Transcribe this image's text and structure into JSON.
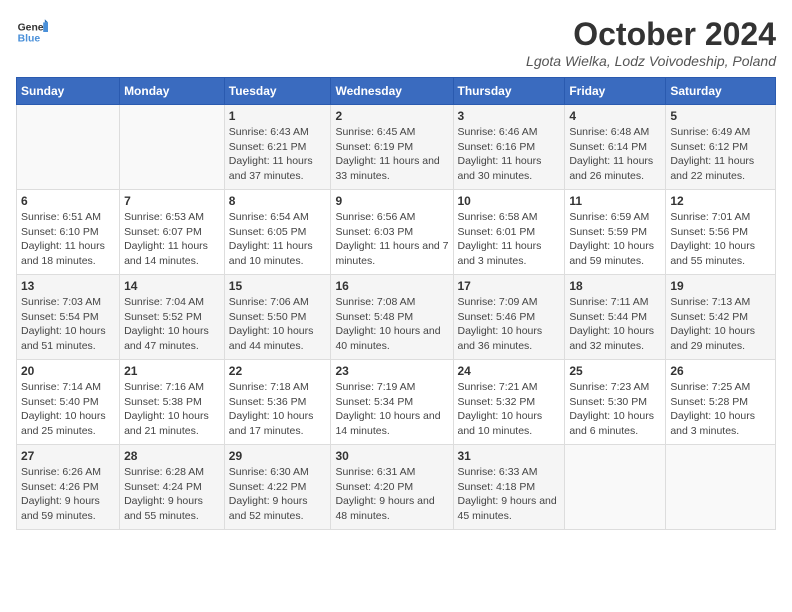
{
  "header": {
    "logo_general": "General",
    "logo_blue": "Blue",
    "title": "October 2024",
    "subtitle": "Lgota Wielka, Lodz Voivodeship, Poland"
  },
  "weekdays": [
    "Sunday",
    "Monday",
    "Tuesday",
    "Wednesday",
    "Thursday",
    "Friday",
    "Saturday"
  ],
  "weeks": [
    [
      {
        "day": "",
        "content": ""
      },
      {
        "day": "",
        "content": ""
      },
      {
        "day": "1",
        "content": "Sunrise: 6:43 AM\nSunset: 6:21 PM\nDaylight: 11 hours\nand 37 minutes."
      },
      {
        "day": "2",
        "content": "Sunrise: 6:45 AM\nSunset: 6:19 PM\nDaylight: 11 hours\nand 33 minutes."
      },
      {
        "day": "3",
        "content": "Sunrise: 6:46 AM\nSunset: 6:16 PM\nDaylight: 11 hours\nand 30 minutes."
      },
      {
        "day": "4",
        "content": "Sunrise: 6:48 AM\nSunset: 6:14 PM\nDaylight: 11 hours\nand 26 minutes."
      },
      {
        "day": "5",
        "content": "Sunrise: 6:49 AM\nSunset: 6:12 PM\nDaylight: 11 hours\nand 22 minutes."
      }
    ],
    [
      {
        "day": "6",
        "content": "Sunrise: 6:51 AM\nSunset: 6:10 PM\nDaylight: 11 hours\nand 18 minutes."
      },
      {
        "day": "7",
        "content": "Sunrise: 6:53 AM\nSunset: 6:07 PM\nDaylight: 11 hours\nand 14 minutes."
      },
      {
        "day": "8",
        "content": "Sunrise: 6:54 AM\nSunset: 6:05 PM\nDaylight: 11 hours\nand 10 minutes."
      },
      {
        "day": "9",
        "content": "Sunrise: 6:56 AM\nSunset: 6:03 PM\nDaylight: 11 hours\nand 7 minutes."
      },
      {
        "day": "10",
        "content": "Sunrise: 6:58 AM\nSunset: 6:01 PM\nDaylight: 11 hours\nand 3 minutes."
      },
      {
        "day": "11",
        "content": "Sunrise: 6:59 AM\nSunset: 5:59 PM\nDaylight: 10 hours\nand 59 minutes."
      },
      {
        "day": "12",
        "content": "Sunrise: 7:01 AM\nSunset: 5:56 PM\nDaylight: 10 hours\nand 55 minutes."
      }
    ],
    [
      {
        "day": "13",
        "content": "Sunrise: 7:03 AM\nSunset: 5:54 PM\nDaylight: 10 hours\nand 51 minutes."
      },
      {
        "day": "14",
        "content": "Sunrise: 7:04 AM\nSunset: 5:52 PM\nDaylight: 10 hours\nand 47 minutes."
      },
      {
        "day": "15",
        "content": "Sunrise: 7:06 AM\nSunset: 5:50 PM\nDaylight: 10 hours\nand 44 minutes."
      },
      {
        "day": "16",
        "content": "Sunrise: 7:08 AM\nSunset: 5:48 PM\nDaylight: 10 hours\nand 40 minutes."
      },
      {
        "day": "17",
        "content": "Sunrise: 7:09 AM\nSunset: 5:46 PM\nDaylight: 10 hours\nand 36 minutes."
      },
      {
        "day": "18",
        "content": "Sunrise: 7:11 AM\nSunset: 5:44 PM\nDaylight: 10 hours\nand 32 minutes."
      },
      {
        "day": "19",
        "content": "Sunrise: 7:13 AM\nSunset: 5:42 PM\nDaylight: 10 hours\nand 29 minutes."
      }
    ],
    [
      {
        "day": "20",
        "content": "Sunrise: 7:14 AM\nSunset: 5:40 PM\nDaylight: 10 hours\nand 25 minutes."
      },
      {
        "day": "21",
        "content": "Sunrise: 7:16 AM\nSunset: 5:38 PM\nDaylight: 10 hours\nand 21 minutes."
      },
      {
        "day": "22",
        "content": "Sunrise: 7:18 AM\nSunset: 5:36 PM\nDaylight: 10 hours\nand 17 minutes."
      },
      {
        "day": "23",
        "content": "Sunrise: 7:19 AM\nSunset: 5:34 PM\nDaylight: 10 hours\nand 14 minutes."
      },
      {
        "day": "24",
        "content": "Sunrise: 7:21 AM\nSunset: 5:32 PM\nDaylight: 10 hours\nand 10 minutes."
      },
      {
        "day": "25",
        "content": "Sunrise: 7:23 AM\nSunset: 5:30 PM\nDaylight: 10 hours\nand 6 minutes."
      },
      {
        "day": "26",
        "content": "Sunrise: 7:25 AM\nSunset: 5:28 PM\nDaylight: 10 hours\nand 3 minutes."
      }
    ],
    [
      {
        "day": "27",
        "content": "Sunrise: 6:26 AM\nSunset: 4:26 PM\nDaylight: 9 hours\nand 59 minutes."
      },
      {
        "day": "28",
        "content": "Sunrise: 6:28 AM\nSunset: 4:24 PM\nDaylight: 9 hours\nand 55 minutes."
      },
      {
        "day": "29",
        "content": "Sunrise: 6:30 AM\nSunset: 4:22 PM\nDaylight: 9 hours\nand 52 minutes."
      },
      {
        "day": "30",
        "content": "Sunrise: 6:31 AM\nSunset: 4:20 PM\nDaylight: 9 hours\nand 48 minutes."
      },
      {
        "day": "31",
        "content": "Sunrise: 6:33 AM\nSunset: 4:18 PM\nDaylight: 9 hours\nand 45 minutes."
      },
      {
        "day": "",
        "content": ""
      },
      {
        "day": "",
        "content": ""
      }
    ]
  ]
}
